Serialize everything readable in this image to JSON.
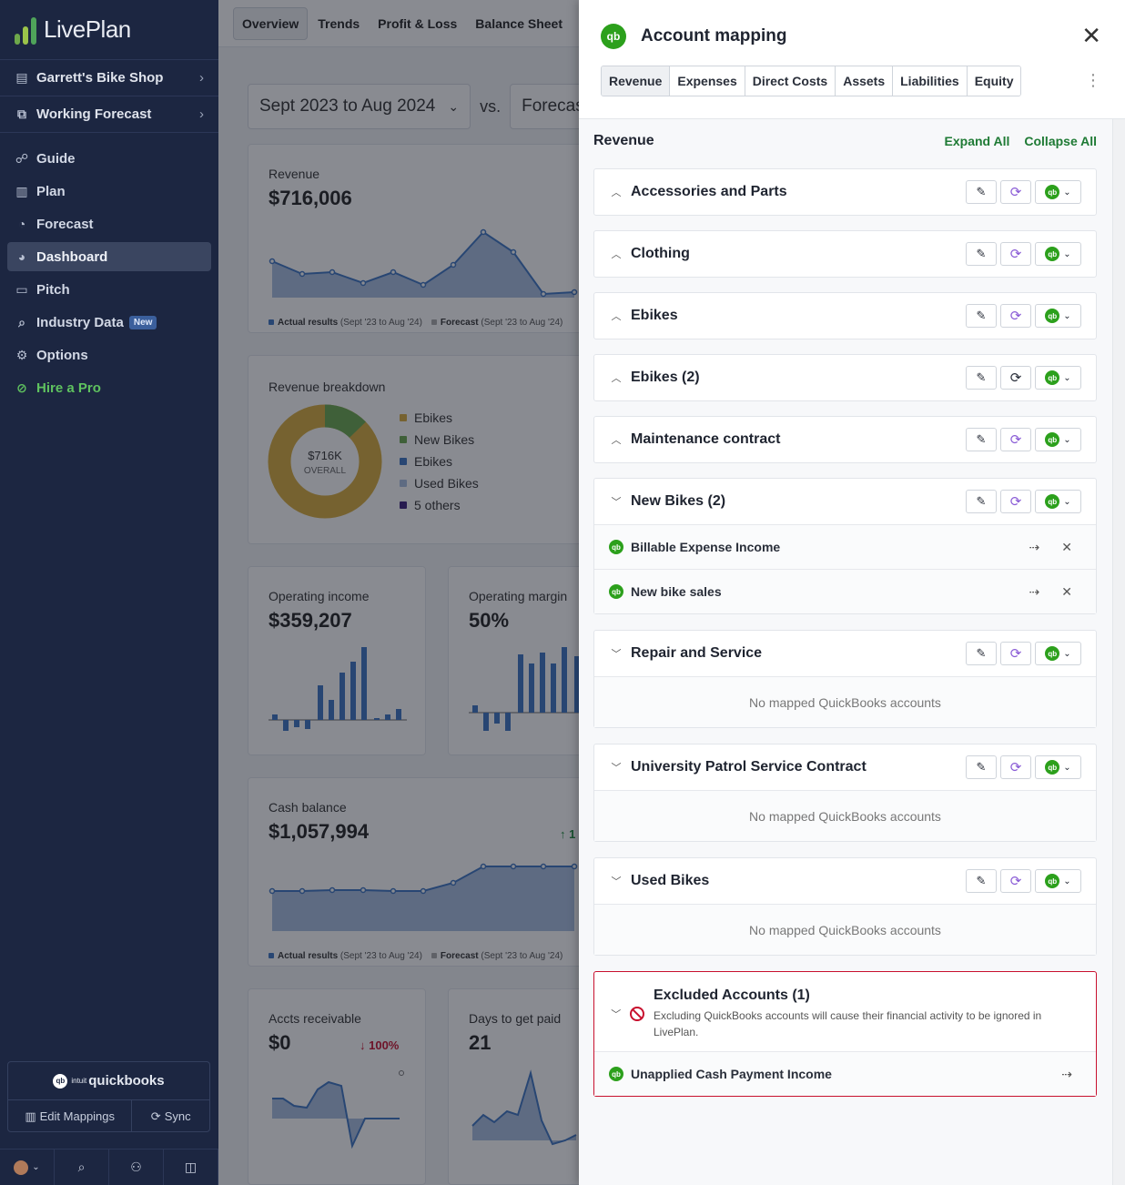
{
  "brand": {
    "name": "LivePlan"
  },
  "sidebar": {
    "business": "Garrett's Bike Shop",
    "forecast": "Working Forecast",
    "nav": [
      {
        "label": "Guide",
        "icon": "guide-icon"
      },
      {
        "label": "Plan",
        "icon": "plan-icon"
      },
      {
        "label": "Forecast",
        "icon": "forecast-icon"
      },
      {
        "label": "Dashboard",
        "icon": "dashboard-icon",
        "active": true
      },
      {
        "label": "Pitch",
        "icon": "pitch-icon"
      },
      {
        "label": "Industry Data",
        "icon": "industry-icon",
        "badge": "New"
      },
      {
        "label": "Options",
        "icon": "gear-icon"
      },
      {
        "label": "Hire a Pro",
        "icon": "hire-icon"
      }
    ],
    "quickbooks": {
      "intuit": "intuit",
      "logo": "quickbooks",
      "edit": "Edit Mappings",
      "sync": "Sync"
    }
  },
  "dashboard": {
    "tabs": [
      "Overview",
      "Trends",
      "Profit & Loss",
      "Balance Sheet"
    ],
    "period": "Sept 2023 to Aug 2024",
    "vs": "vs.",
    "compare": "Forecas",
    "revenue": {
      "title": "Revenue",
      "value": "$716,006"
    },
    "legend": {
      "actual": "Actual results",
      "actual_range": "(Sept '23 to Aug '24)",
      "forecast": "Forecast",
      "forecast_range": "(Sept '23 to Aug '24)"
    },
    "breakdown": {
      "title": "Revenue breakdown",
      "center_value": "$716K",
      "center_label": "OVERALL",
      "items": [
        "Ebikes",
        "New Bikes",
        "Ebikes",
        "Used Bikes",
        "5 others"
      ]
    },
    "operating_income": {
      "title": "Operating income",
      "value": "$359,207"
    },
    "operating_margin": {
      "title": "Operating margin",
      "value": "50%"
    },
    "cash": {
      "title": "Cash balance",
      "value": "$1,057,994",
      "change": "↑ 1"
    },
    "ar": {
      "title": "Accts receivable",
      "value": "$0",
      "change": "↓ 100%"
    },
    "days": {
      "title": "Days to get paid",
      "value": "21"
    }
  },
  "drawer": {
    "title": "Account mapping",
    "tabs": [
      "Revenue",
      "Expenses",
      "Direct Costs",
      "Assets",
      "Liabilities",
      "Equity"
    ],
    "section": "Revenue",
    "expand_all": "Expand All",
    "collapse_all": "Collapse All",
    "groups": [
      {
        "name": "Accessories and Parts",
        "caret": "up"
      },
      {
        "name": "Clothing",
        "caret": "up"
      },
      {
        "name": "Ebikes",
        "caret": "up"
      },
      {
        "name": "Ebikes (2)",
        "caret": "up"
      },
      {
        "name": "Maintenance contract",
        "caret": "up"
      },
      {
        "name": "New Bikes (2)",
        "caret": "down",
        "accounts": [
          "Billable Expense Income",
          "New bike sales"
        ]
      },
      {
        "name": "Repair and Service",
        "caret": "down",
        "empty": "No mapped QuickBooks accounts"
      },
      {
        "name": "University Patrol Service Contract",
        "caret": "down",
        "empty": "No mapped QuickBooks accounts"
      },
      {
        "name": "Used Bikes",
        "caret": "down",
        "empty": "No mapped QuickBooks accounts"
      }
    ],
    "excluded": {
      "title": "Excluded Accounts (1)",
      "desc": "Excluding QuickBooks accounts will cause their financial activity to be ignored in LivePlan.",
      "accounts": [
        "Unapplied Cash Payment Income"
      ]
    }
  },
  "colors": {
    "qb_green": "#2ca01c",
    "link_green": "#1e7a34",
    "sidebar": "#1c2641",
    "danger": "#c8102e",
    "series_blue": "#3d75c2"
  }
}
